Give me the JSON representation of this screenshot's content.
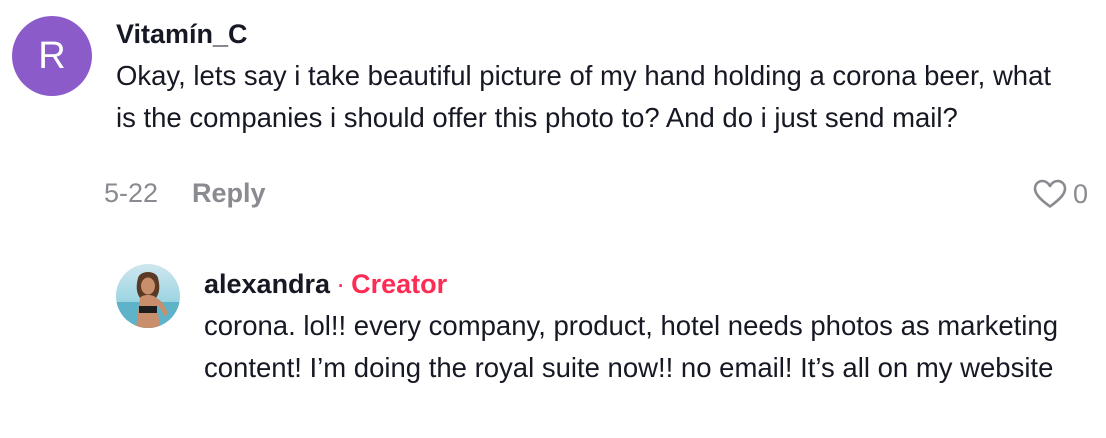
{
  "comment": {
    "avatar_letter": "R",
    "avatar_color": "#8a5bc9",
    "username": "Vitamín_C",
    "text": "Okay, lets say i take beautiful picture of my hand holding a corona beer, what is the companies i should offer this photo to? And do i just send mail?",
    "date": "5-22",
    "reply_label": "Reply",
    "like_icon": "heart-outline-icon",
    "like_count": "0"
  },
  "reply": {
    "avatar_description": "avatar",
    "username": "alexandra",
    "separator": "·",
    "badge": "Creator",
    "badge_color": "#fe2c55",
    "text": "corona. lol!! every company, product, hotel needs photos as marketing content! I’m doing the royal suite now!! no email! It’s all on my website"
  }
}
